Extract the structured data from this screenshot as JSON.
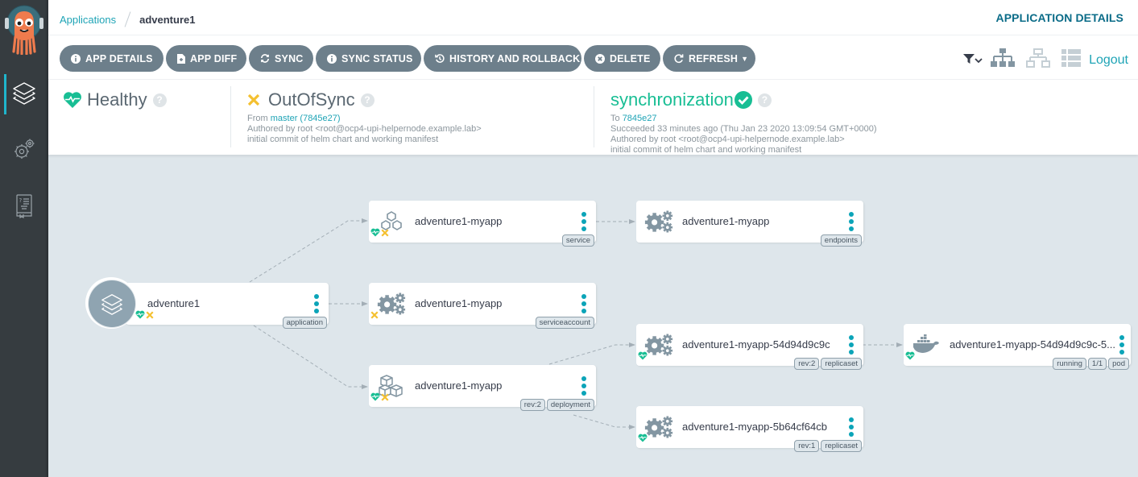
{
  "header": {
    "breadcrumb_root": "Applications",
    "breadcrumb_current": "adventure1",
    "page_title": "APPLICATION DETAILS"
  },
  "sidebar": {
    "items": [
      {
        "name": "applications",
        "icon": "layers-icon",
        "active": true
      },
      {
        "name": "settings",
        "icon": "gears-icon",
        "active": false
      },
      {
        "name": "user-info",
        "icon": "docs-book-icon",
        "active": false
      }
    ]
  },
  "toolbar": {
    "buttons": [
      {
        "label": "APP DETAILS",
        "icon": "info-circle-icon"
      },
      {
        "label": "APP DIFF",
        "icon": "file-diff-icon"
      },
      {
        "label": "SYNC",
        "icon": "sync-icon"
      },
      {
        "label": "SYNC STATUS",
        "icon": "info-circle-icon"
      },
      {
        "label": "HISTORY AND ROLLBACK",
        "icon": "history-icon"
      },
      {
        "label": "DELETE",
        "icon": "times-circle-icon"
      },
      {
        "label": "REFRESH",
        "icon": "redo-icon",
        "dropdown": true
      }
    ],
    "logout_label": "Logout"
  },
  "status": {
    "health": {
      "label": "Healthy",
      "color": "#18be94"
    },
    "sync": {
      "label": "OutOfSync",
      "color": "#f4c030",
      "from_prefix": "From",
      "from_link": "master (7845e27)",
      "author": "Authored by root <root@ocp4-upi-helpernode.example.lab>",
      "message": "initial commit of helm chart and working manifest"
    },
    "operation": {
      "label": "synchronization",
      "to_prefix": "To",
      "to_link": "7845e27",
      "succeeded": "Succeeded 33 minutes ago (Thu Jan 23 2020 13:09:54 GMT+0000)",
      "author": "Authored by root <root@ocp4-upi-helpernode.example.lab>",
      "message": "initial commit of helm chart and working manifest"
    }
  },
  "graph": {
    "nodes": [
      {
        "id": "app",
        "name": "adventure1",
        "kind": "application",
        "health": "healthy",
        "sync": "out-of-sync",
        "tags": [
          "application"
        ]
      },
      {
        "id": "svc",
        "name": "adventure1-myapp",
        "kind": "service",
        "health": "healthy",
        "sync": "out-of-sync",
        "tags": [
          "service"
        ]
      },
      {
        "id": "ep",
        "name": "adventure1-myapp",
        "kind": "endpoints",
        "health": null,
        "sync": null,
        "tags": [
          "endpoints"
        ]
      },
      {
        "id": "sa",
        "name": "adventure1-myapp",
        "kind": "serviceaccount",
        "health": null,
        "sync": "out-of-sync",
        "tags": [
          "serviceaccount"
        ]
      },
      {
        "id": "deploy",
        "name": "adventure1-myapp",
        "kind": "deployment",
        "health": "healthy",
        "sync": "out-of-sync",
        "tags": [
          "rev:2",
          "deployment"
        ]
      },
      {
        "id": "rs2",
        "name": "adventure1-myapp-54d94d9c9c",
        "kind": "replicaset",
        "health": "healthy",
        "sync": null,
        "tags": [
          "rev:2",
          "replicaset"
        ]
      },
      {
        "id": "rs1",
        "name": "adventure1-myapp-5b64cf64cb",
        "kind": "replicaset",
        "health": "healthy",
        "sync": null,
        "tags": [
          "rev:1",
          "replicaset"
        ]
      },
      {
        "id": "pod",
        "name": "adventure1-myapp-54d94d9c9c-5...",
        "kind": "pod",
        "health": "healthy",
        "sync": null,
        "tags": [
          "running",
          "1/1",
          "pod"
        ]
      }
    ],
    "edges": [
      [
        "app",
        "svc"
      ],
      [
        "app",
        "sa"
      ],
      [
        "app",
        "deploy"
      ],
      [
        "svc",
        "ep"
      ],
      [
        "deploy",
        "rs2"
      ],
      [
        "deploy",
        "rs1"
      ],
      [
        "rs2",
        "pod"
      ]
    ]
  }
}
